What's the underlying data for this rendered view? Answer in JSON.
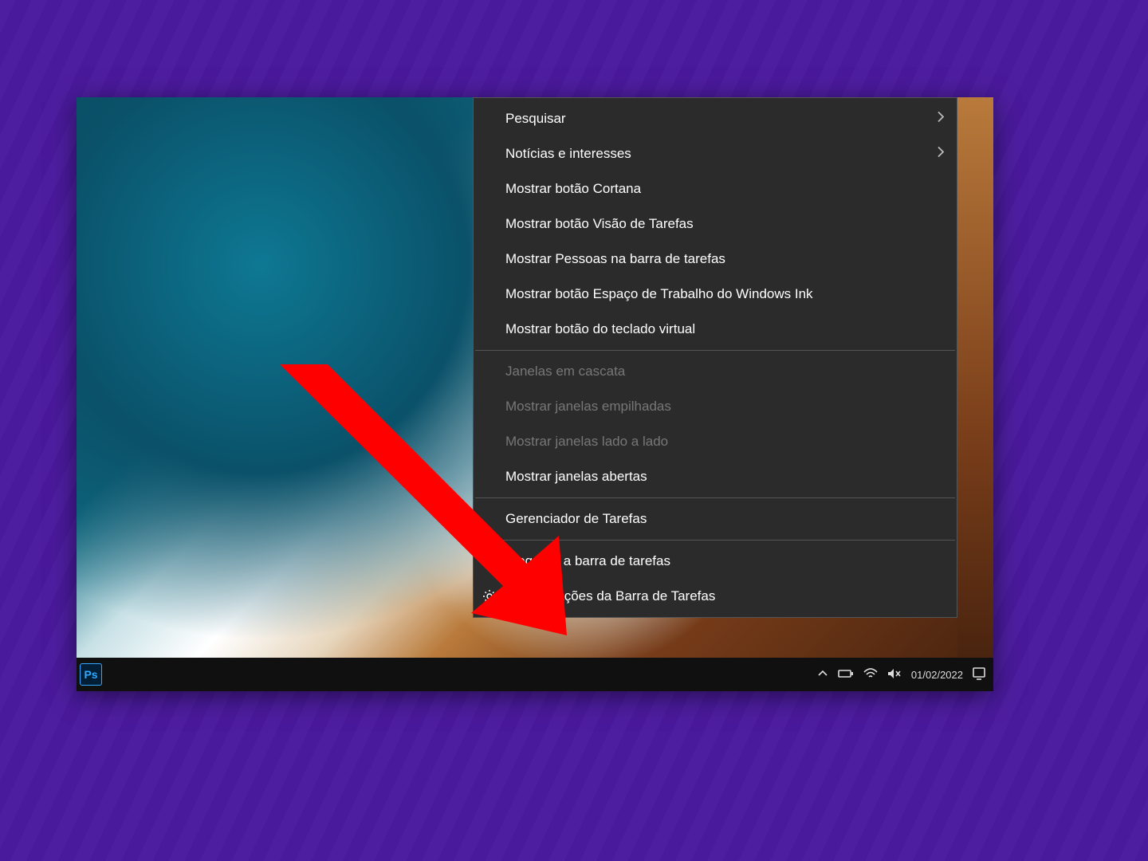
{
  "context_menu": {
    "items": [
      {
        "label": "Pesquisar",
        "submenu": true,
        "enabled": true,
        "icon": null
      },
      {
        "label": "Notícias e interesses",
        "submenu": true,
        "enabled": true,
        "icon": null
      },
      {
        "label": "Mostrar botão Cortana",
        "submenu": false,
        "enabled": true,
        "icon": null
      },
      {
        "label": "Mostrar botão Visão de Tarefas",
        "submenu": false,
        "enabled": true,
        "icon": null
      },
      {
        "label": "Mostrar Pessoas na barra de tarefas",
        "submenu": false,
        "enabled": true,
        "icon": null
      },
      {
        "label": "Mostrar botão Espaço de Trabalho do Windows Ink",
        "submenu": false,
        "enabled": true,
        "icon": null
      },
      {
        "label": "Mostrar botão do teclado virtual",
        "submenu": false,
        "enabled": true,
        "icon": null
      },
      {
        "separator": true
      },
      {
        "label": "Janelas em cascata",
        "submenu": false,
        "enabled": false,
        "icon": null
      },
      {
        "label": "Mostrar janelas empilhadas",
        "submenu": false,
        "enabled": false,
        "icon": null
      },
      {
        "label": "Mostrar janelas lado a lado",
        "submenu": false,
        "enabled": false,
        "icon": null
      },
      {
        "label": "Mostrar janelas abertas",
        "submenu": false,
        "enabled": true,
        "icon": null
      },
      {
        "separator": true
      },
      {
        "label": "Gerenciador de Tarefas",
        "submenu": false,
        "enabled": true,
        "icon": null
      },
      {
        "separator": true
      },
      {
        "label": "Bloquear a barra de tarefas",
        "submenu": false,
        "enabled": true,
        "icon": "check"
      },
      {
        "label": "Configurações da Barra de Tarefas",
        "submenu": false,
        "enabled": true,
        "icon": "gear"
      }
    ]
  },
  "taskbar": {
    "apps": {
      "photoshop_abbr": "Ps"
    },
    "tray": {
      "date": "01/02/2022"
    }
  },
  "annotation": {
    "arrow_color": "#ff0000"
  }
}
